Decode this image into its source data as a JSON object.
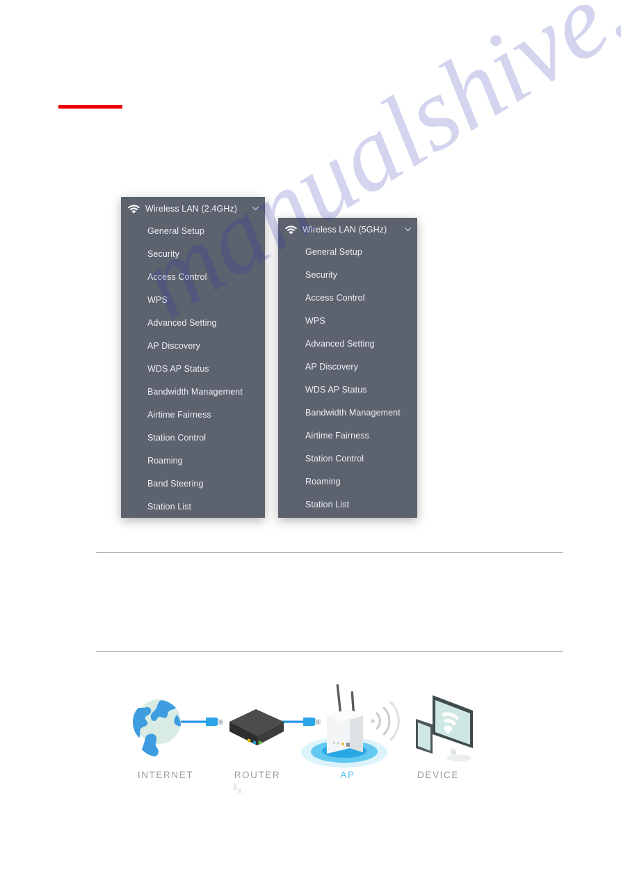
{
  "page": {
    "accent_red": "#ee0000",
    "panel_bg": "#5c626e",
    "panel_text": "#eceef1",
    "divider_color": "#9a9a9a",
    "ap_label_color": "#53bdf0",
    "label_color": "#9b9b9b"
  },
  "watermark": {
    "text": "manualshive.com"
  },
  "menus": [
    {
      "id": "wireless-lan-24ghz",
      "title": "Wireless LAN (2.4GHz)",
      "icon": "wifi-icon",
      "expand_icon": "chevron-down-icon",
      "items": [
        "General Setup",
        "Security",
        "Access Control",
        "WPS",
        "Advanced Setting",
        "AP Discovery",
        "WDS AP Status",
        "Bandwidth Management",
        "Airtime Fairness",
        "Station Control",
        "Roaming",
        "Band Steering",
        "Station List"
      ]
    },
    {
      "id": "wireless-lan-5ghz",
      "title": "Wireless LAN (5GHz)",
      "icon": "wifi-icon",
      "expand_icon": "chevron-down-icon",
      "items": [
        "General Setup",
        "Security",
        "Access Control",
        "WPS",
        "Advanced Setting",
        "AP Discovery",
        "WDS AP Status",
        "Bandwidth Management",
        "Airtime Fairness",
        "Station Control",
        "Roaming",
        "Station List"
      ]
    }
  ],
  "topology": {
    "nodes": [
      {
        "id": "internet",
        "label": "INTERNET",
        "icon": "globe-icon",
        "highlighted": false
      },
      {
        "id": "router",
        "label": "ROUTER",
        "icon": "router-icon",
        "highlighted": false
      },
      {
        "id": "ap",
        "label": "AP",
        "icon": "access-point-icon",
        "highlighted": true
      },
      {
        "id": "device",
        "label": "DEVICE",
        "icon": "devices-icon",
        "highlighted": false
      }
    ]
  }
}
